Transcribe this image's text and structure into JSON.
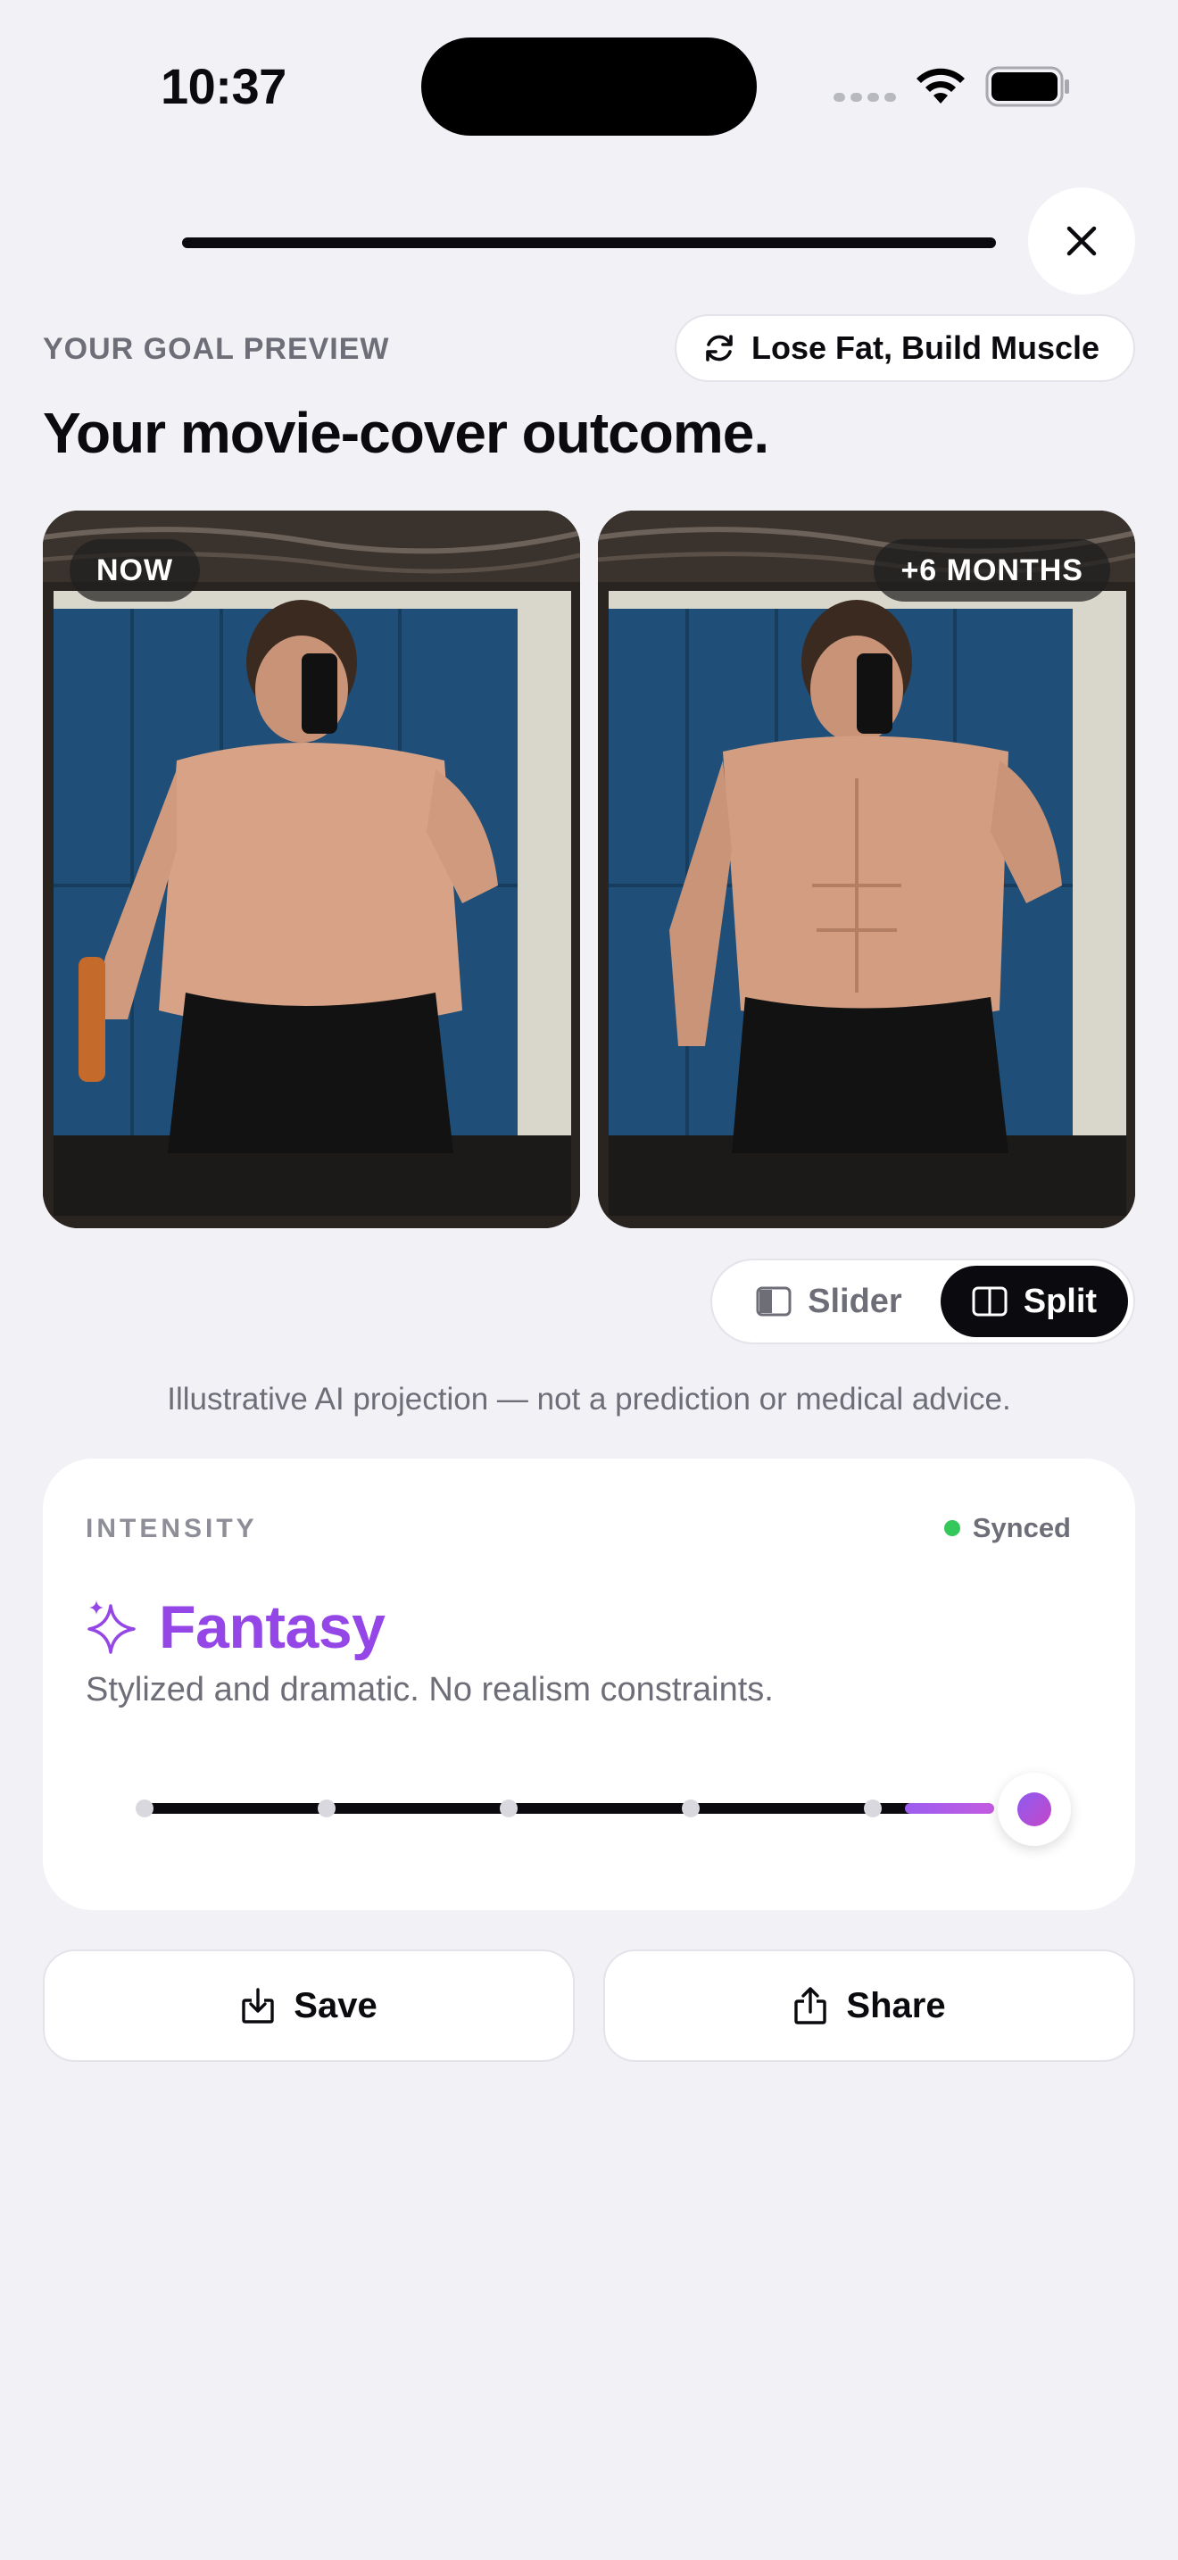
{
  "status_bar": {
    "time": "10:37"
  },
  "header": {
    "eyebrow": "YOUR GOAL PREVIEW",
    "goal_chip_label": "Lose Fat, Build Muscle",
    "headline": "Your movie-cover outcome."
  },
  "preview": {
    "before_label": "NOW",
    "after_label": "+6 MONTHS"
  },
  "view_toggle": {
    "options": [
      "Slider",
      "Split"
    ],
    "selected": "Split"
  },
  "disclaimer": "Illustrative AI projection — not a prediction or medical advice.",
  "intensity": {
    "eyebrow": "INTENSITY",
    "sync_status": "Synced",
    "mode_title": "Fantasy",
    "mode_description": "Stylized and dramatic. No realism constraints.",
    "level": 6,
    "levels_total": 6
  },
  "actions": {
    "save_label": "Save",
    "share_label": "Share"
  },
  "colors": {
    "accent_purple": "#9447e6",
    "synced_green": "#34c759",
    "background": "#f1f1f6"
  }
}
